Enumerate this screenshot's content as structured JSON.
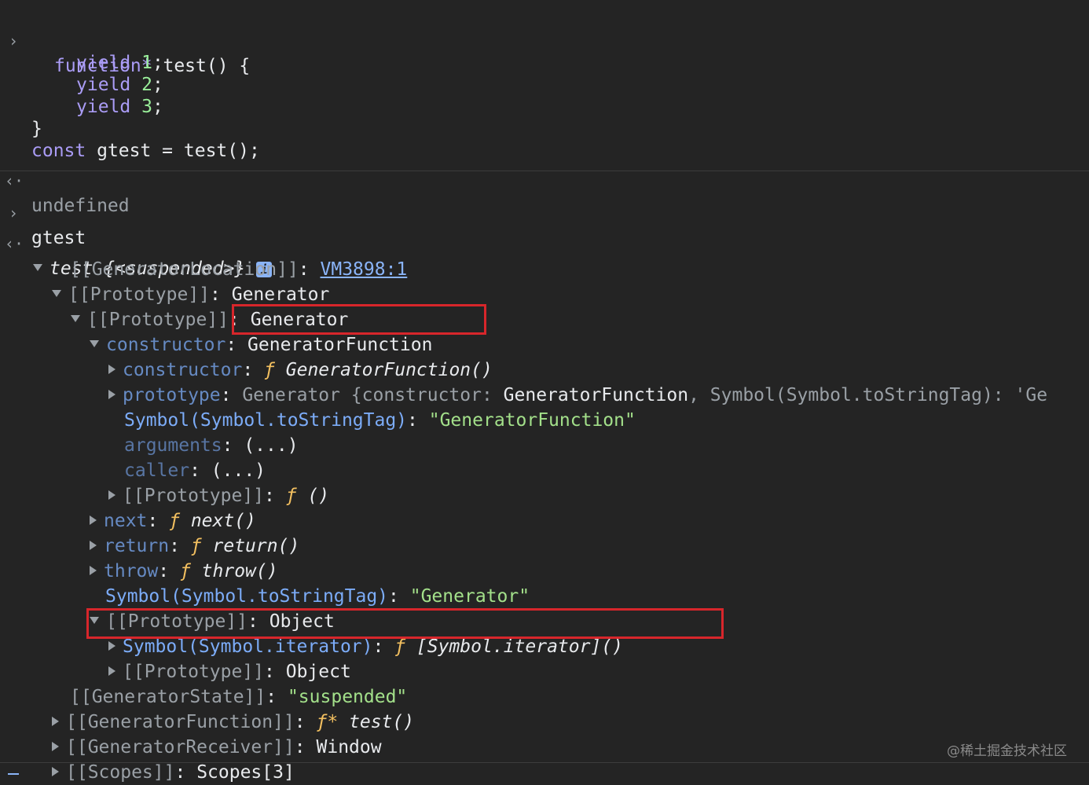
{
  "code_block": {
    "line1_kw": "function*",
    "line1_rest": " test() {",
    "yield_kw": "yield",
    "y1": "1",
    "y2": "2",
    "y3": "3",
    "semi": ";",
    "close_brace": "}",
    "const_kw": "const",
    "const_rest": " gtest = test();",
    "result": "undefined"
  },
  "input2": "gtest",
  "tree": {
    "root_name": "test",
    "root_state": "{<suspended>}",
    "info_label": "i",
    "gen_location_key": "[[GeneratorLocation]]",
    "gen_location_val": "VM3898:1",
    "proto_key": "[[Prototype]]",
    "generator": "Generator",
    "constructor_key": "constructor",
    "generator_function": "GeneratorFunction",
    "f": "ƒ",
    "fstar": "ƒ*",
    "gf_call": "GeneratorFunction()",
    "prototype_key": "prototype",
    "prototype_preview_a": "Generator {constructor: ",
    "prototype_preview_b": "GeneratorFunction",
    "prototype_preview_c": ", Symbol(Symbol.toStringTag): 'Ge",
    "tostringtag_key": "Symbol(Symbol.toStringTag)",
    "tostringtag_gf_val": "\"GeneratorFunction\"",
    "arguments_key": "arguments",
    "caller_key": "caller",
    "ellipsis": "(...)",
    "empty_call": "()",
    "next_key": "next",
    "next_call": "next()",
    "return_key": "return",
    "return_call": "return()",
    "throw_key": "throw",
    "throw_call": "throw()",
    "tostringtag_gen_val": "\"Generator\"",
    "object": "Object",
    "iterator_key": "Symbol(Symbol.iterator)",
    "iterator_call": "[Symbol.iterator]()",
    "gen_state_key": "[[GeneratorState]]",
    "gen_state_val": "\"suspended\"",
    "gen_function_key": "[[GeneratorFunction]]",
    "test_call": "test()",
    "gen_receiver_key": "[[GeneratorReceiver]]",
    "window": "Window",
    "scopes_key": "[[Scopes]]",
    "scopes_val": "Scopes[3]"
  },
  "watermark": "@稀土掘金技术社区",
  "colors": {
    "background": "#242424",
    "highlight_box": "#d7262b",
    "key": "#7cacf8",
    "string": "#a3e08a",
    "keyword": "#aa9cf5"
  }
}
